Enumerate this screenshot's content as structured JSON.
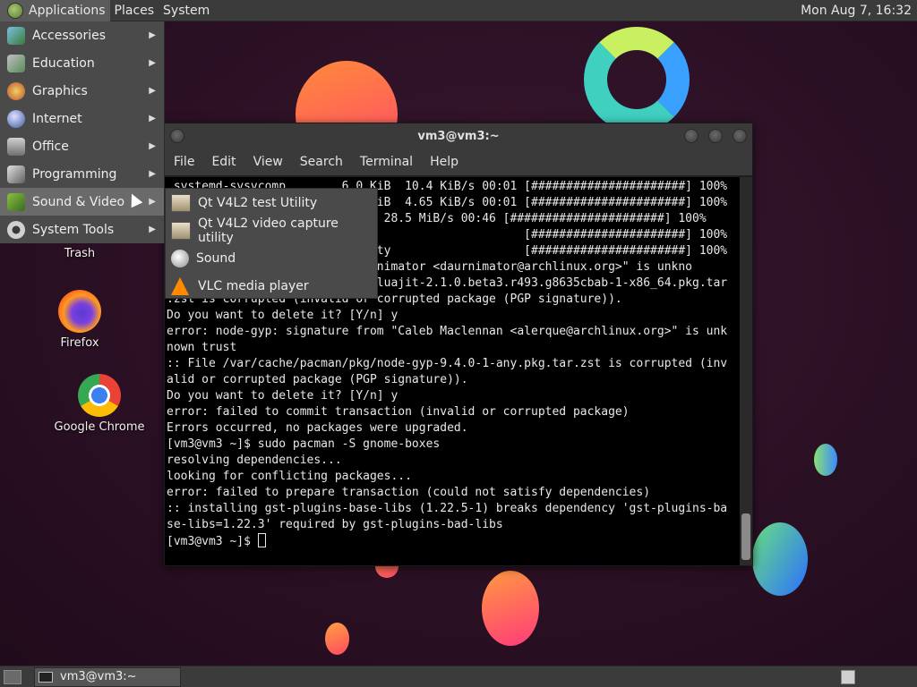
{
  "top_panel": {
    "menus": [
      "Applications",
      "Places",
      "System"
    ],
    "clock": "Mon Aug  7, 16:32"
  },
  "app_menu": {
    "items": [
      {
        "label": "Accessories",
        "icon": "accessories-icon"
      },
      {
        "label": "Education",
        "icon": "education-icon"
      },
      {
        "label": "Graphics",
        "icon": "graphics-icon"
      },
      {
        "label": "Internet",
        "icon": "internet-icon"
      },
      {
        "label": "Office",
        "icon": "office-icon"
      },
      {
        "label": "Programming",
        "icon": "programming-icon"
      },
      {
        "label": "Sound & Video",
        "icon": "sound-video-icon"
      },
      {
        "label": "System Tools",
        "icon": "system-tools-icon"
      }
    ],
    "submenu": [
      {
        "label": "Qt V4L2 test Utility",
        "icon": "qt-v4l2-icon"
      },
      {
        "label": "Qt V4L2 video capture utility",
        "icon": "qt-v4l2-capture-icon"
      },
      {
        "label": "Sound",
        "icon": "sound-icon"
      },
      {
        "label": "VLC media player",
        "icon": "vlc-icon"
      }
    ]
  },
  "desktop_icons": {
    "trash": "Trash",
    "firefox": "Firefox",
    "chrome": "Google Chrome"
  },
  "terminal": {
    "title": "vm3@vm3:~",
    "menus": [
      "File",
      "Edit",
      "View",
      "Search",
      "Terminal",
      "Help"
    ],
    "lines": [
      " systemd-sysvcomp...     6.0 KiB  10.4 KiB/s 00:01 [######################] 100%",
      "                         4.6 KiB  4.65 KiB/s 00:01 [######################] 100%",
      "                          MiB  28.5 MiB/s 00:46 [######################] 100%",
      "                          ring                     [######################] 100%",
      "                          egrity                   [######################] 100%",
      "                         \"Daurnimator <daurnimator@archlinux.org>\" is unkno",
      ":: File /var/cache/pacman/pkg/luajit-2.1.0.beta3.r493.g8635cbab-1-x86_64.pkg.tar",
      ".zst is corrupted (invalid or corrupted package (PGP signature)).",
      "Do you want to delete it? [Y/n] y",
      "error: node-gyp: signature from \"Caleb Maclennan <alerque@archlinux.org>\" is unk",
      "nown trust",
      ":: File /var/cache/pacman/pkg/node-gyp-9.4.0-1-any.pkg.tar.zst is corrupted (inv",
      "alid or corrupted package (PGP signature)).",
      "Do you want to delete it? [Y/n] y",
      "error: failed to commit transaction (invalid or corrupted package)",
      "Errors occurred, no packages were upgraded.",
      "[vm3@vm3 ~]$ sudo pacman -S gnome-boxes",
      "resolving dependencies...",
      "looking for conflicting packages...",
      "error: failed to prepare transaction (could not satisfy dependencies)",
      ":: installing gst-plugins-base-libs (1.22.5-1) breaks dependency 'gst-plugins-ba",
      "se-libs=1.22.3' required by gst-plugins-bad-libs"
    ],
    "prompt": "[vm3@vm3 ~]$ "
  },
  "bottom_panel": {
    "task_label": "vm3@vm3:~"
  }
}
